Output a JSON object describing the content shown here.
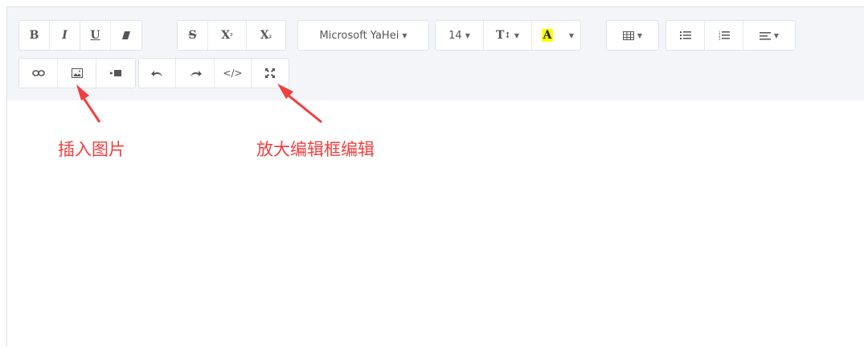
{
  "toolbar": {
    "bold": "B",
    "italic": "I",
    "underline": "U",
    "strike": "S",
    "superscript": "X",
    "superscript_mark": "²",
    "subscript": "X",
    "subscript_mark": "₂",
    "font_family": "Microsoft YaHei",
    "font_size": "14",
    "line_height": "T",
    "line_height_mark": "↕",
    "font_color": "A",
    "code": "</>"
  },
  "annotations": {
    "insert_image": "插入图片",
    "fullscreen": "放大编辑框编辑"
  },
  "colors": {
    "accent_red": "#f23e3e",
    "highlight_yellow": "#ffff00"
  }
}
